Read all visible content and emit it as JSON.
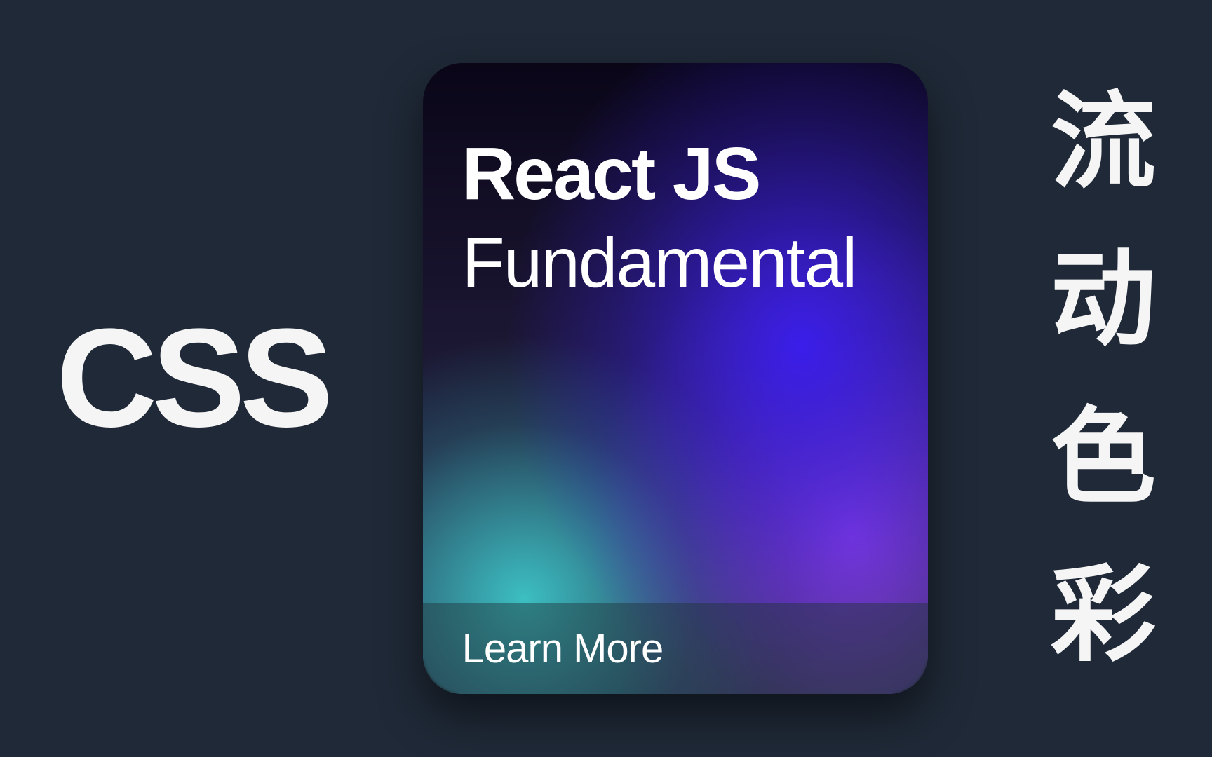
{
  "left_label": "CSS",
  "card": {
    "title": "React JS",
    "subtitle": "Fundamental",
    "cta": "Learn More"
  },
  "right_label": {
    "char1": "流",
    "char2": "动",
    "char3": "色",
    "char4": "彩"
  },
  "colors": {
    "background": "#1f2937",
    "text": "#f5f5f5",
    "gradient_blue": "#3b1eea",
    "gradient_purple": "#8b3fd6",
    "gradient_teal": "#3cbfc2",
    "gradient_dark": "#0a0618"
  }
}
